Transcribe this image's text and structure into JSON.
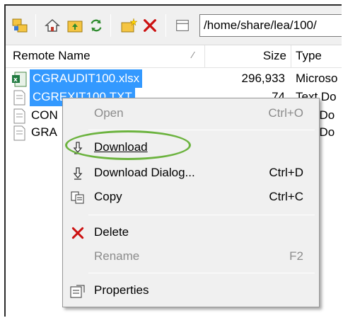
{
  "toolbar": {
    "path": "/home/share/lea/100/"
  },
  "columns": {
    "remote_name": "Remote Name",
    "size": "Size",
    "type": "Type"
  },
  "files": [
    {
      "name": "CGRAUDIT100.xlsx",
      "size": "296,933",
      "type": "Microso"
    },
    {
      "name": "CGREXIT100.TXT",
      "size": "74",
      "type": "Text Do"
    },
    {
      "name": "CON",
      "size": "",
      "type": "t Do"
    },
    {
      "name": "GRA",
      "size": "",
      "type": "t Do"
    }
  ],
  "menu": {
    "open": {
      "label": "Open",
      "shortcut": "Ctrl+O"
    },
    "download": {
      "label": "Download"
    },
    "download_dialog": {
      "label": "Download Dialog...",
      "shortcut": "Ctrl+D"
    },
    "copy": {
      "label": "Copy",
      "shortcut": "Ctrl+C"
    },
    "delete": {
      "label": "Delete"
    },
    "rename": {
      "label": "Rename",
      "shortcut": "F2"
    },
    "properties": {
      "label": "Properties"
    }
  },
  "colors": {
    "selection": "#3399ff",
    "annotation": "#6cb33f",
    "delete": "#cc1111"
  }
}
